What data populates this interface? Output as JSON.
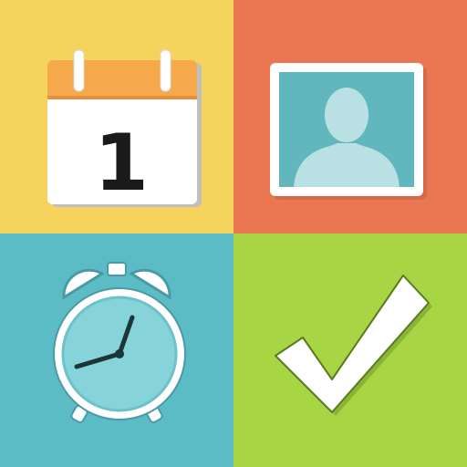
{
  "app_icon": {
    "tiles": [
      {
        "name": "calendar",
        "icon": "calendar-icon",
        "background": "#f6d35d",
        "number": "1"
      },
      {
        "name": "contact",
        "icon": "contact-photo-icon",
        "background": "#ea7752"
      },
      {
        "name": "alarm",
        "icon": "alarm-clock-icon",
        "background": "#5bbcc6"
      },
      {
        "name": "task",
        "icon": "checkmark-icon",
        "background": "#a8d544"
      }
    ],
    "colors": {
      "yellow": "#f6d35d",
      "orange": "#ea7752",
      "teal": "#5bbcc6",
      "green": "#a8d544",
      "calendar_header": "#f6a94a",
      "photo_frame": "#62b7bf",
      "alarm_face": "#86d3d9"
    }
  }
}
